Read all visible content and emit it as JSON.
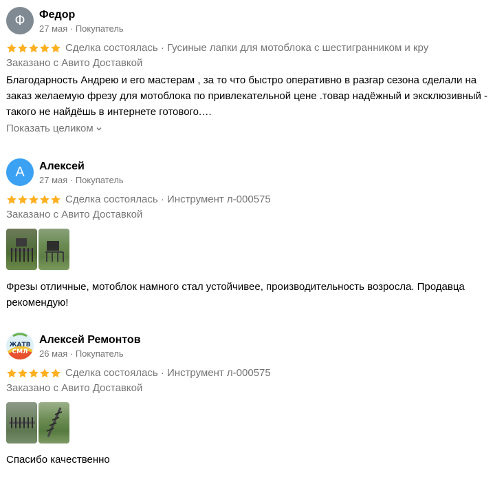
{
  "reviews": [
    {
      "avatar_letter": "Ф",
      "name": "Федор",
      "meta": "27 мая · Покупатель",
      "deal": "Сделка состоялась · Гусиные лапки для мотоблока с шестигранником и кру",
      "delivery": "Заказано с Авито Доставкой",
      "text": "Благодарность Андрею и его мастерам , за то что быстро оперативно в разгар сезона сделали на заказ желаемую фрезу для мотоблока по привлекательной цене .товар надёжный и эксклюзивный - такого не найдёшь в интернете готового.…",
      "more": "Показать целиком",
      "rating": 5
    },
    {
      "avatar_letter": "А",
      "name": "Алексей",
      "meta": "27 мая · Покупатель",
      "deal": "Сделка состоялась · Инструмент л-000575",
      "delivery": "Заказано с Авито Доставкой",
      "text": "Фрезы отличные, мотоблок намного стал устойчивее, производительность возросла. Продавца рекомендую!",
      "rating": 5
    },
    {
      "avatar_text": "ЖАТВ СМЛ",
      "name": "Алексей Ремонтов",
      "meta": "26 мая · Покупатель",
      "deal": "Сделка состоялась · Инструмент л-000575",
      "delivery": "Заказано с Авито Доставкой",
      "text": "Спасибо качественно",
      "rating": 5
    }
  ],
  "colors": {
    "star": "#ffb021",
    "muted": "#757575",
    "avatar_grey": "#7f8a93",
    "avatar_blue": "#3ba1f3"
  },
  "icons": {
    "star": "star-icon",
    "more": "chevron-down-icon"
  }
}
